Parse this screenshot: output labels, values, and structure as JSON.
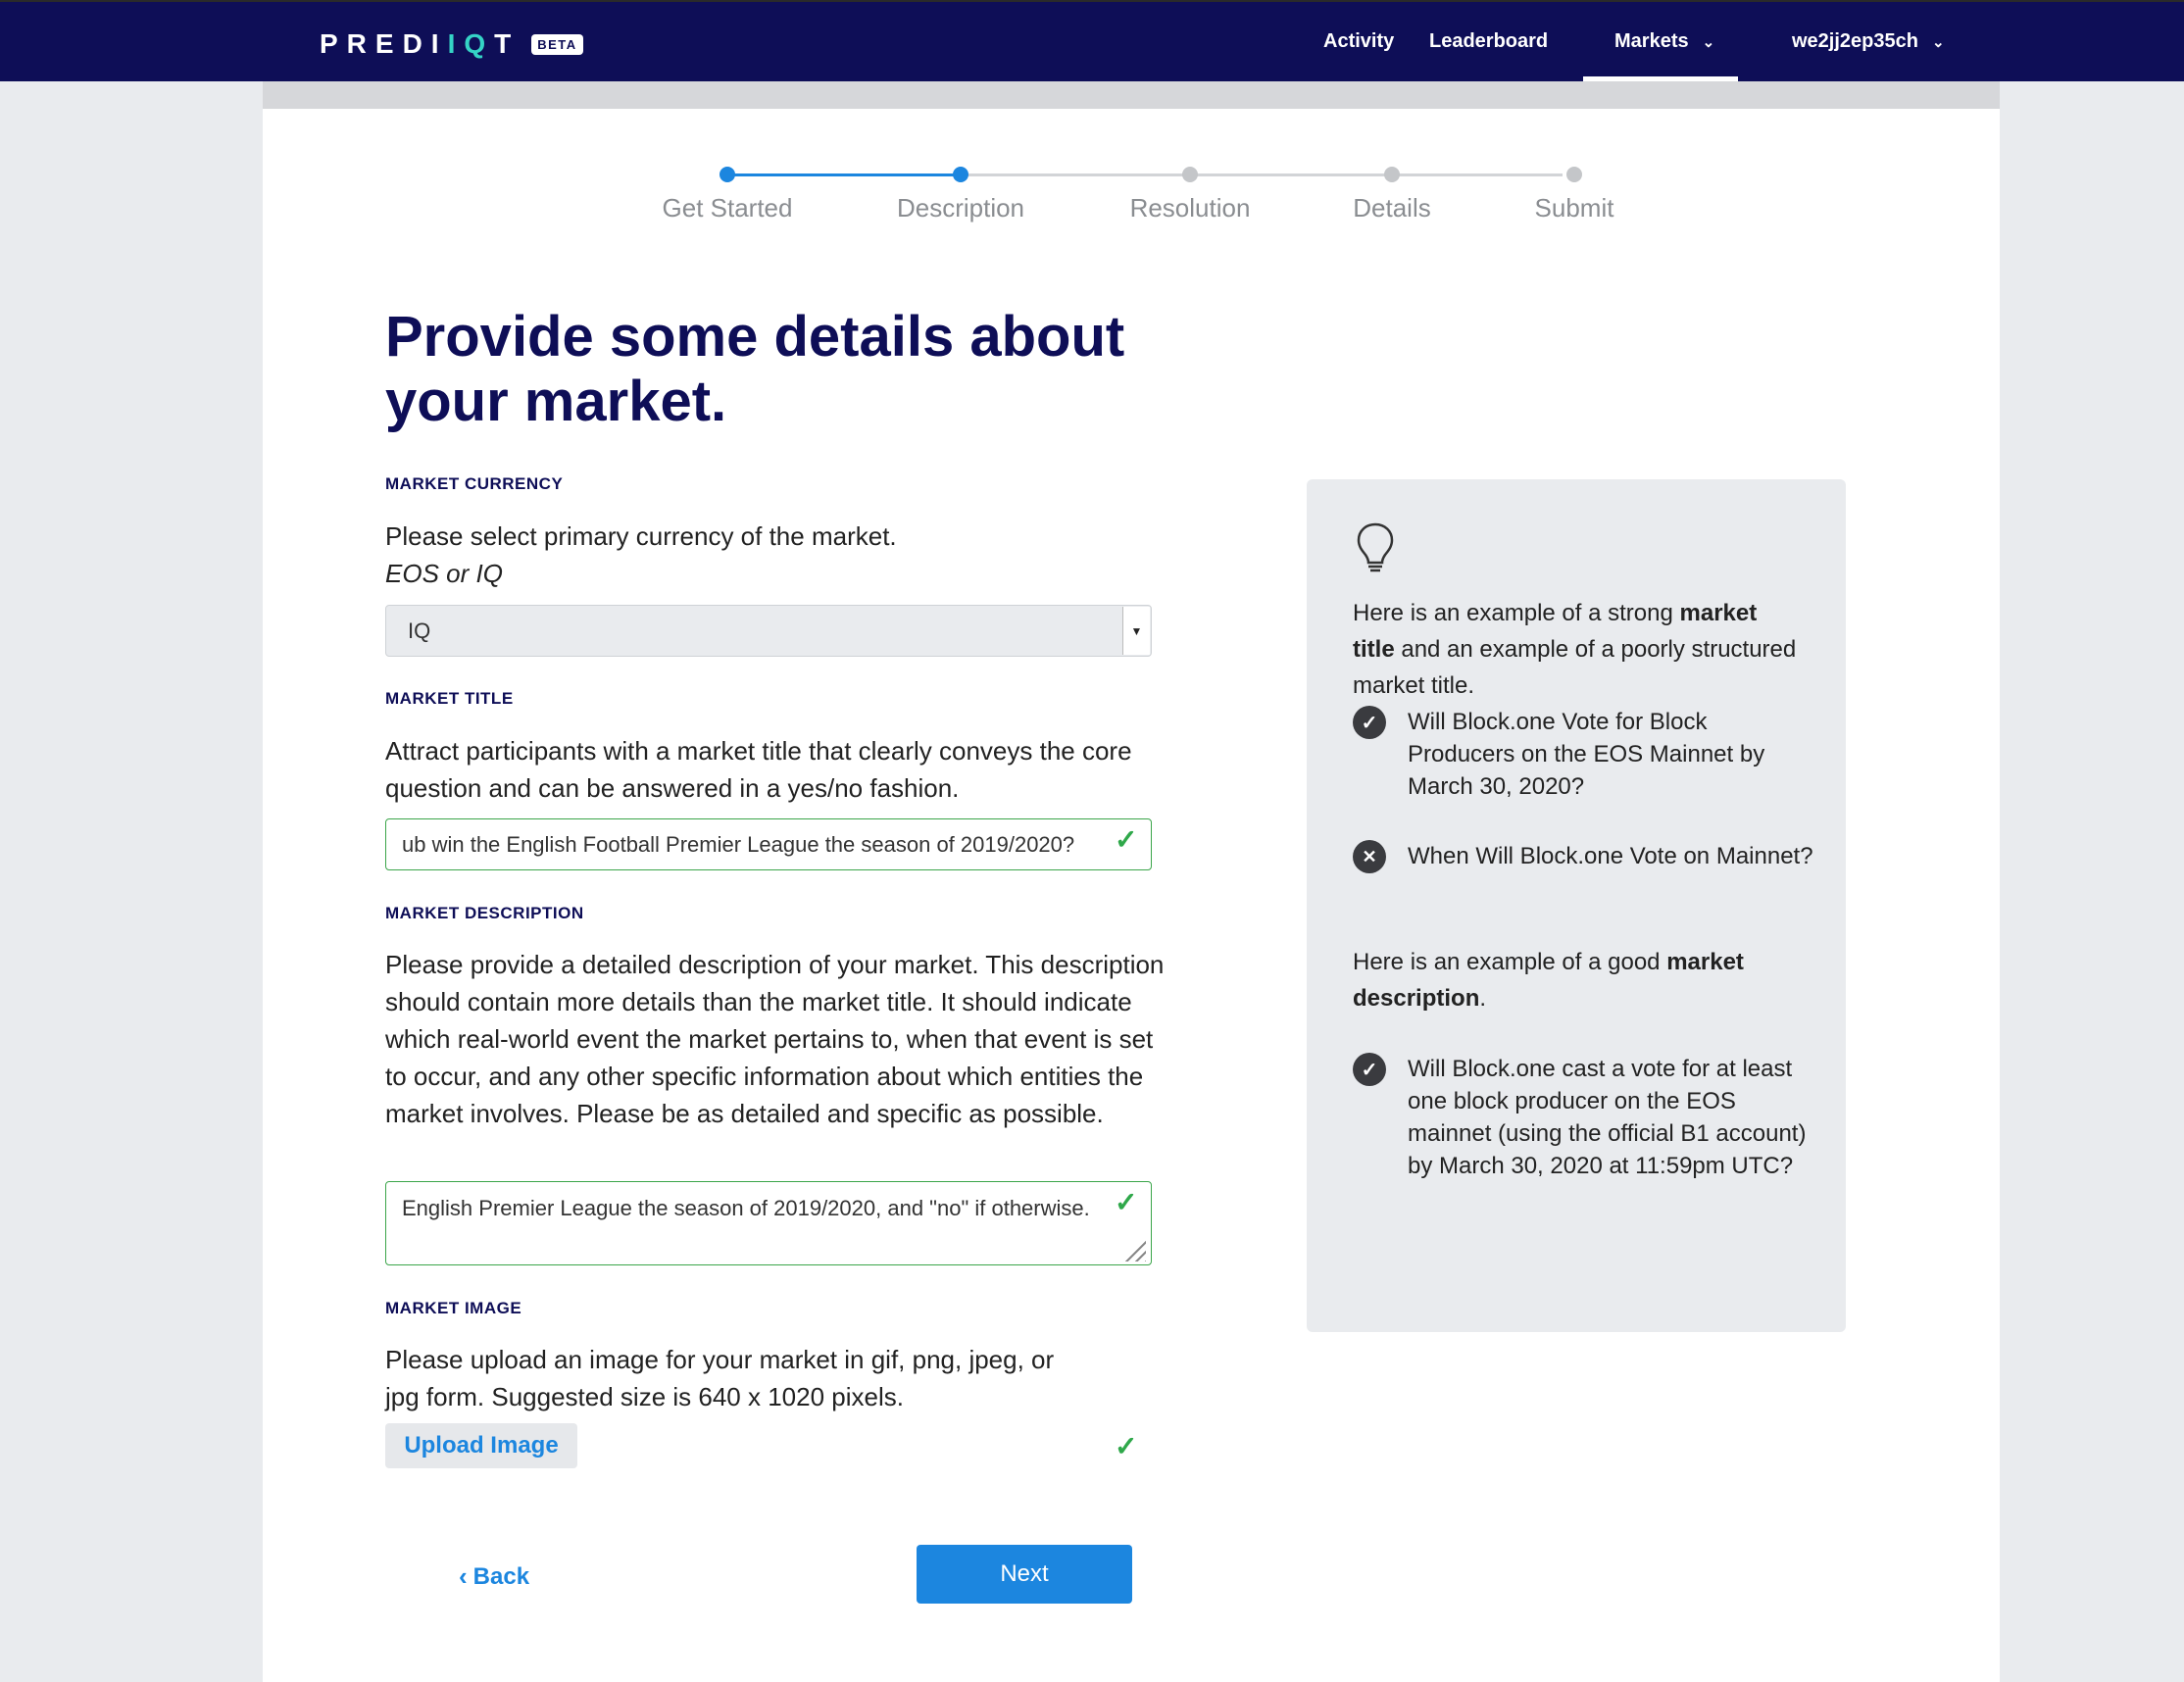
{
  "nav": {
    "logo_main": "PREDI",
    "logo_accent": "IQ",
    "logo_end": "T",
    "beta": "BETA",
    "items": [
      "Activity",
      "Leaderboard",
      "Markets",
      "we2jj2ep35ch"
    ],
    "active": "Markets"
  },
  "stepper": {
    "steps": [
      "Get Started",
      "Description",
      "Resolution",
      "Details",
      "Submit"
    ],
    "current_step": 2
  },
  "page": {
    "title": "Provide some details about your market."
  },
  "currency": {
    "label": "MARKET CURRENCY",
    "help": "Please select primary currency of the market.",
    "help_italic": "EOS or IQ",
    "selected": "IQ"
  },
  "market_title": {
    "label": "MARKET TITLE",
    "help": "Attract participants with a market title that clearly conveys the core question and can be answered in a yes/no fashion.",
    "value": "ub win the English Football Premier League the season of 2019/2020?"
  },
  "market_description": {
    "label": "MARKET DESCRIPTION",
    "help": "Please provide a detailed description of your market. This description should contain more details than the market title. It should indicate which real-world event the market pertains to, when that event is set to occur, and any other specific information about which entities the market involves. Please be as detailed and specific as possible.",
    "value": "English Premier League the season of 2019/2020, and \"no\" if otherwise."
  },
  "market_image": {
    "label": "MARKET IMAGE",
    "help": "Please upload an image for your market in gif, png, jpeg, or jpg form. Suggested size is 640 x 1020 pixels.",
    "button": "Upload Image"
  },
  "actions": {
    "back": "Back",
    "next": "Next"
  },
  "tip": {
    "icon": "lightbulb-icon",
    "intro_1": "Here is an example of a strong ",
    "intro_bold_1": "market title",
    "intro_2": " and an example of a poorly structured market title.",
    "good_title": "Will Block.one Vote for Block Producers on the EOS Mainnet by March 30, 2020?",
    "bad_title": "When Will Block.one Vote on Mainnet?",
    "desc_intro_1": "Here is an example of a good ",
    "desc_intro_bold": "market description",
    "desc_intro_2": ".",
    "good_description": "Will Block.one cast a vote for at least one block producer on the EOS mainnet (using the official B1 account) by March 30, 2020 at 11:59pm UTC?"
  },
  "colors": {
    "navbar": "#0e0e57",
    "accent": "#1c86df",
    "valid": "#2fa84a",
    "logo_accent": "#35d3c6"
  }
}
